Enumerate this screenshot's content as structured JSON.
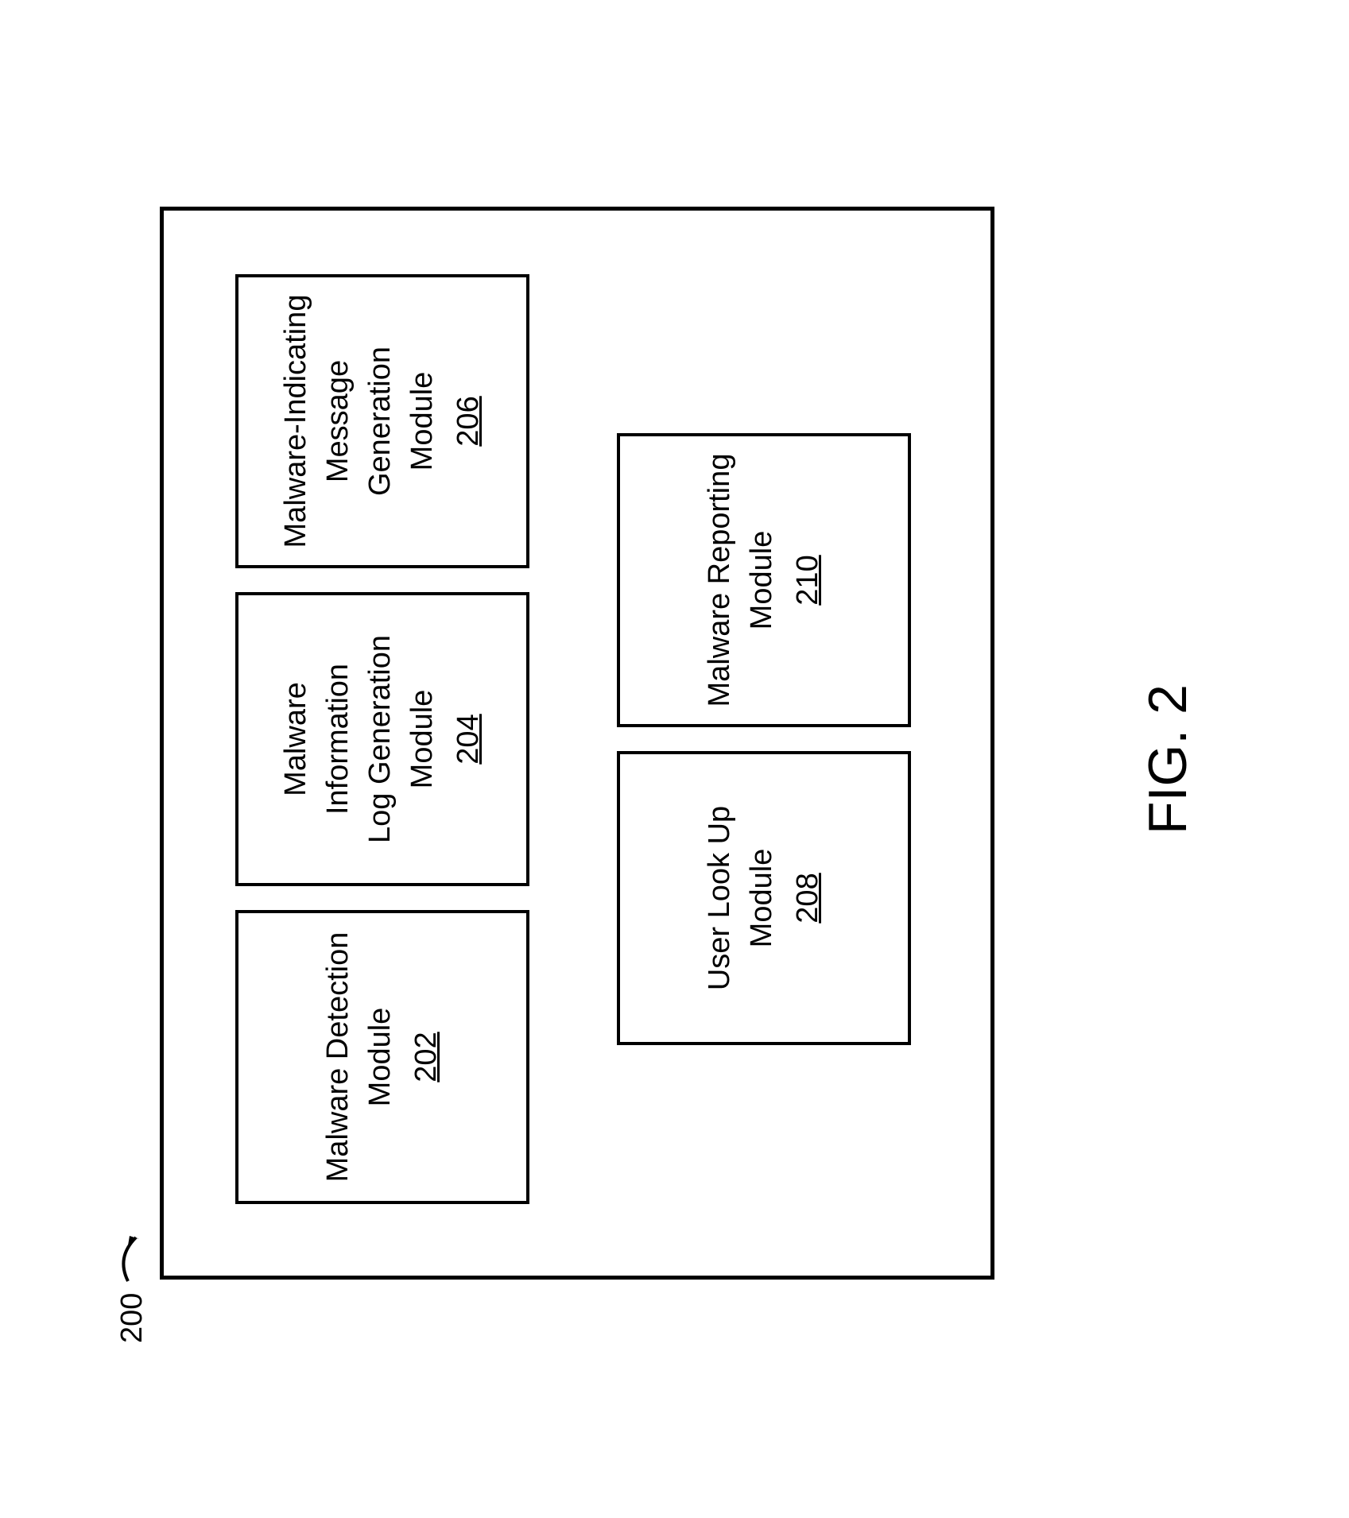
{
  "ref": "200",
  "figure_label": "FIG. 2",
  "modules": {
    "m1": {
      "title": "Malware Detection\nModule",
      "ref": "202"
    },
    "m2": {
      "title": "Malware Information\nLog Generation\nModule",
      "ref": "204"
    },
    "m3": {
      "title": "Malware-Indicating\nMessage\nGeneration Module",
      "ref": "206"
    },
    "m4": {
      "title": "User Look Up\nModule",
      "ref": "208"
    },
    "m5": {
      "title": "Malware Reporting\nModule",
      "ref": "210"
    }
  }
}
